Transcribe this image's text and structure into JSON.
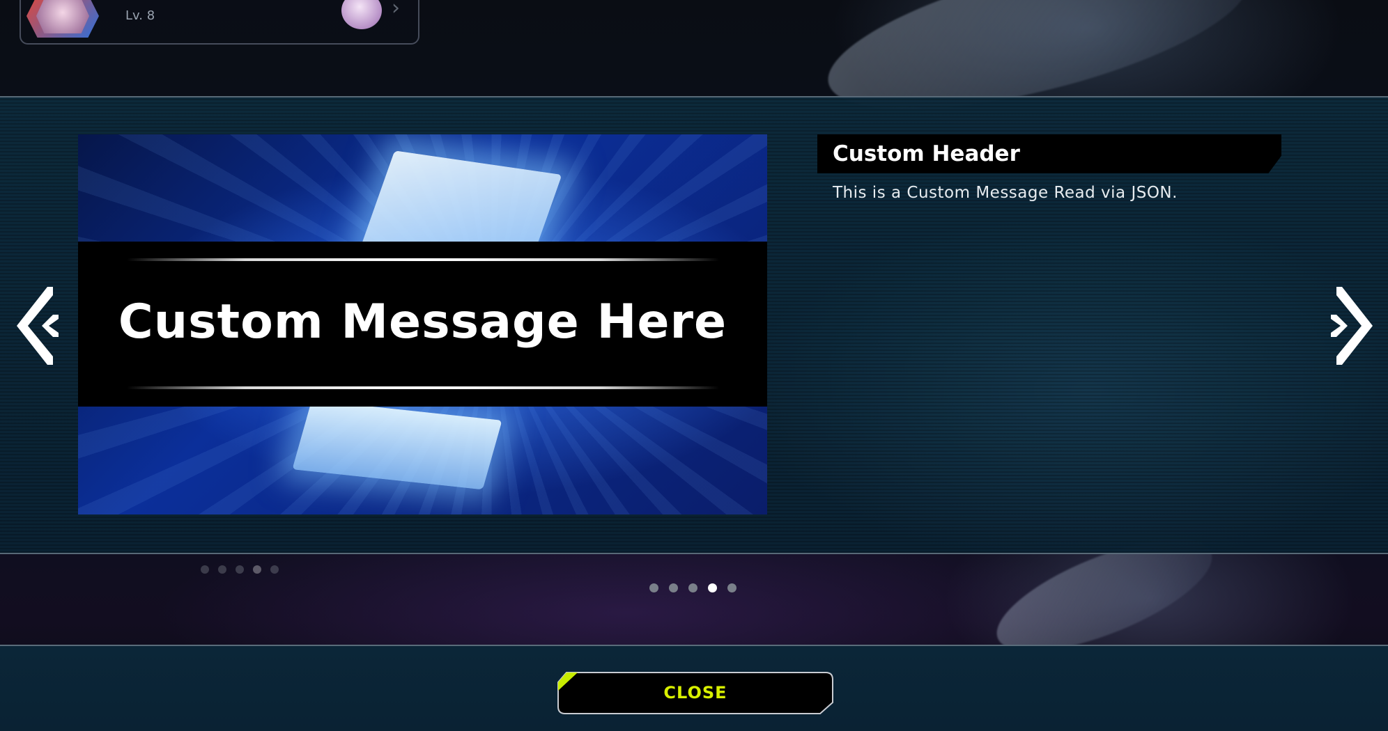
{
  "player": {
    "rank_label": "Lv. 8"
  },
  "banner": {
    "title": "Custom Message Here"
  },
  "info": {
    "header": "Custom Header",
    "message": "This is a Custom Message Read via JSON."
  },
  "navigation": {
    "prev_icon": "chevron-double-left-icon",
    "next_icon": "chevron-double-right-icon"
  },
  "pager": {
    "total": 5,
    "current": 4
  },
  "footer": {
    "close_label": "CLOSE"
  },
  "colors": {
    "accent": "#d8f000",
    "panel": "#0b2637",
    "dot_active": "#ffffff",
    "dot_inactive": "#7a808a"
  }
}
